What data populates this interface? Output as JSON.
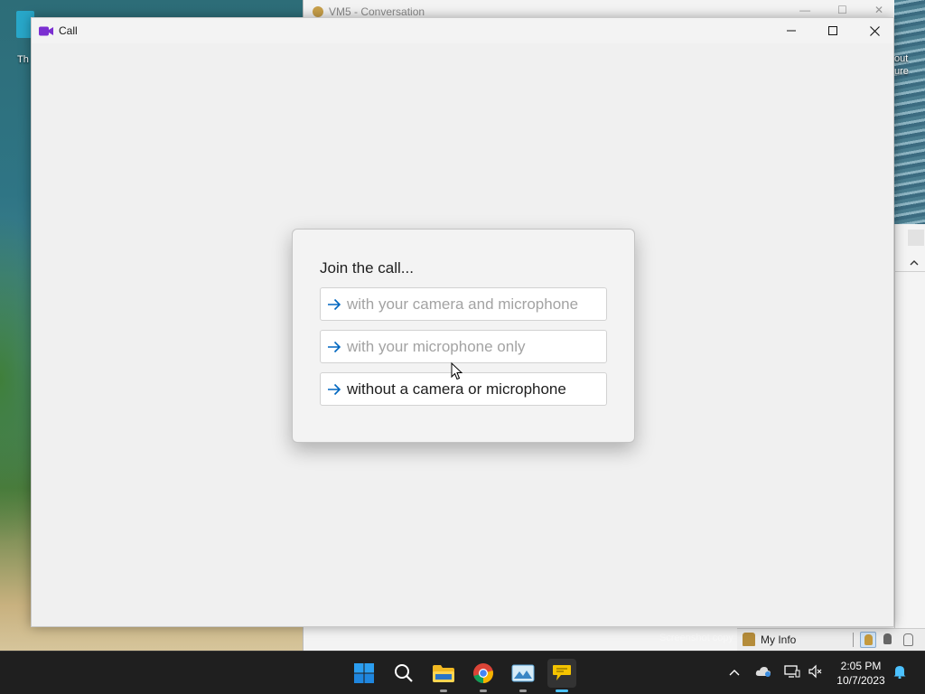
{
  "desktop": {
    "left_text": "Th",
    "right_text_1": "out",
    "right_text_2": "ure"
  },
  "background_window": {
    "title": "VM5 - Conversation",
    "status_bar": {
      "my_info_label": "My Info",
      "watermark": "Screenshot copy"
    }
  },
  "call_window": {
    "title": "Call",
    "controls": {
      "minimize_icon": "minimize-icon",
      "maximize_icon": "maximize-icon",
      "close_icon": "close-icon"
    },
    "join_dialog": {
      "heading": "Join the call...",
      "options": [
        {
          "label": "with your camera and microphone",
          "enabled": false,
          "icon": "arrow-right-icon"
        },
        {
          "label": "with your microphone only",
          "enabled": false,
          "icon": "arrow-right-icon"
        },
        {
          "label": "without a camera or microphone",
          "enabled": true,
          "icon": "arrow-right-icon"
        }
      ]
    }
  },
  "taskbar": {
    "apps": [
      {
        "name": "start",
        "icon": "windows-start-icon"
      },
      {
        "name": "search",
        "icon": "search-icon"
      },
      {
        "name": "file-explorer",
        "icon": "folder-icon"
      },
      {
        "name": "chrome",
        "icon": "chrome-icon"
      },
      {
        "name": "photos",
        "icon": "image-icon"
      },
      {
        "name": "messenger",
        "icon": "chat-bubble-icon"
      }
    ],
    "clock": {
      "time": "2:05 PM",
      "date": "10/7/2023"
    }
  },
  "colors": {
    "accent_arrow": "#0067c0",
    "disabled_text": "#a3a3a3",
    "app_icon": "#7b2fd1"
  }
}
